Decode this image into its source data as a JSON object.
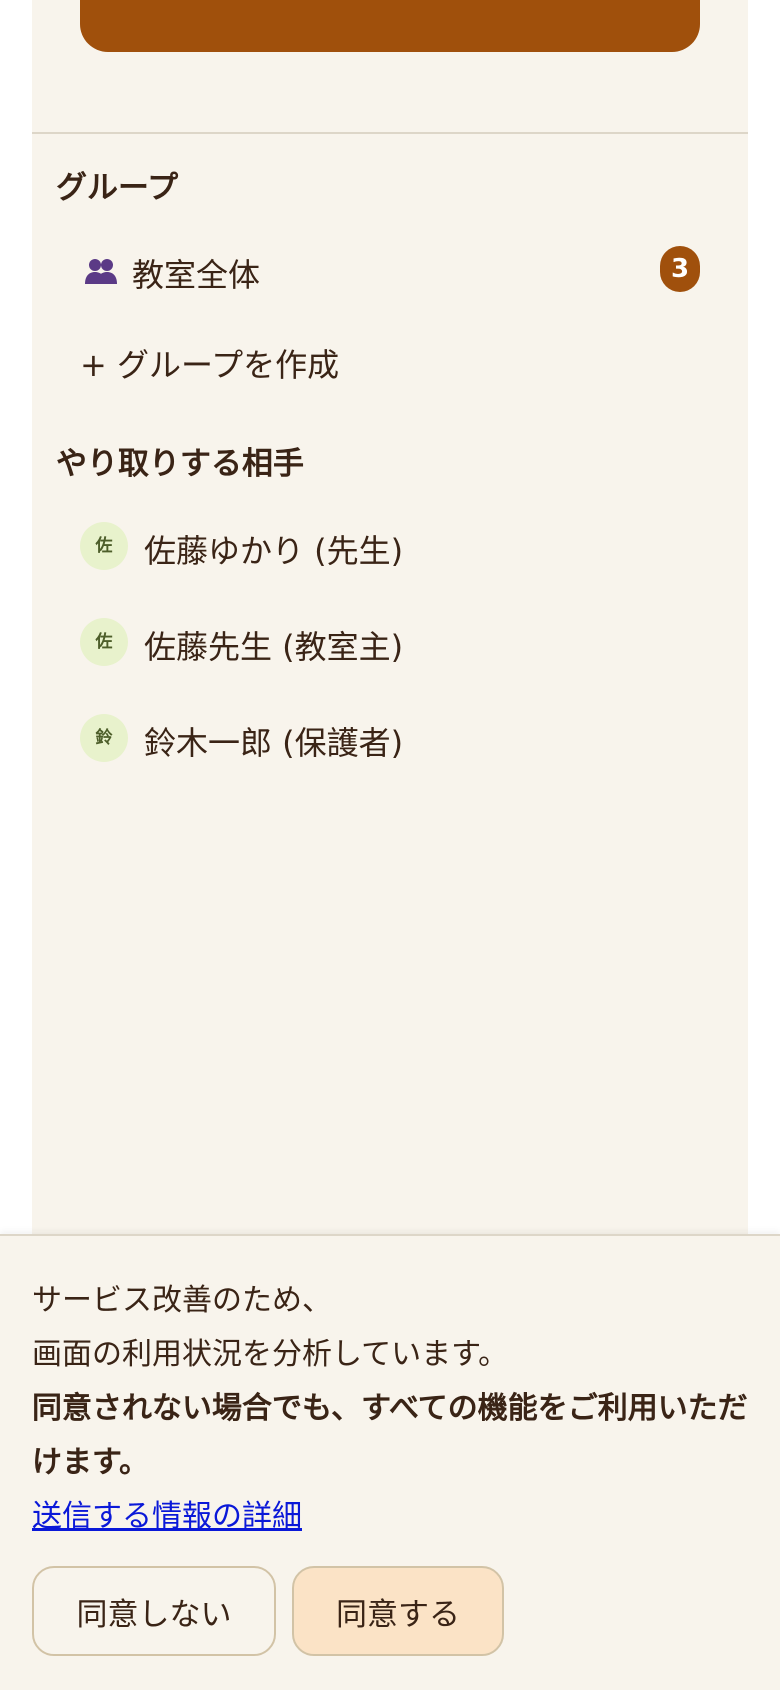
{
  "sidebar": {
    "groups_heading": "グループ",
    "groups": [
      {
        "icon": "group-icon",
        "label": "教室全体",
        "unread_count": "3"
      }
    ],
    "create_group_label": "+ グループを作成",
    "contacts_heading": "やり取りする相手",
    "contacts": [
      {
        "avatar": "佐",
        "name": "佐藤ゆかり (先生)"
      },
      {
        "avatar": "佐",
        "name": "佐藤先生 (教室主)"
      },
      {
        "avatar": "鈴",
        "name": "鈴木一郎 (保護者)"
      }
    ]
  },
  "consent": {
    "line1": "サービス改善のため、",
    "line2": "画面の利用状況を分析しています。",
    "line3": "同意されない場合でも、すべての機能をご利用いただけます。",
    "details_link": "送信する情報の詳細",
    "decline_label": "同意しない",
    "accept_label": "同意する"
  },
  "colors": {
    "accent": "#a0500c",
    "panel_background": "#f8f4ec",
    "avatar_background": "#e8f2cc",
    "accept_background": "#fbe3c6",
    "link": "#0a18d8"
  }
}
